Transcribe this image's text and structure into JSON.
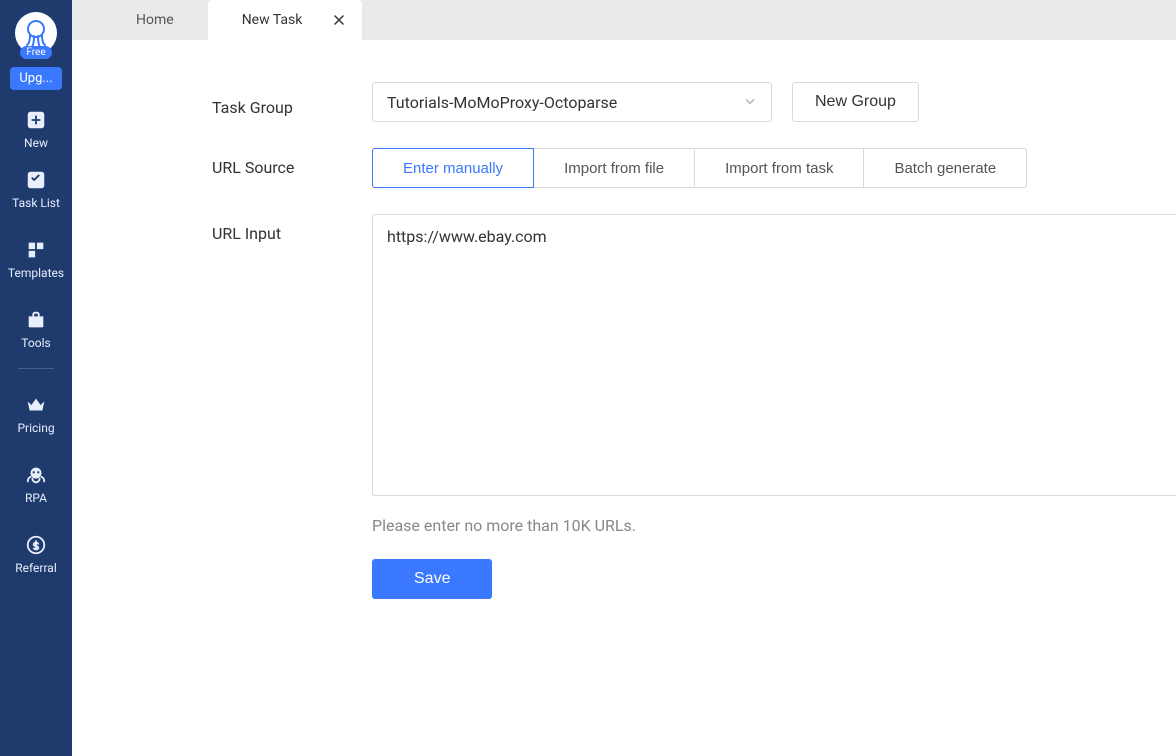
{
  "sidebar": {
    "free_badge": "Free",
    "upgrade_label": "Upg...",
    "items": {
      "new": "New",
      "task_list": "Task List",
      "templates": "Templates",
      "tools": "Tools",
      "pricing": "Pricing",
      "rpa": "RPA",
      "referral": "Referral"
    }
  },
  "tabs": {
    "home": "Home",
    "new_task": "New Task"
  },
  "content": {
    "task_group_label": "Task Group",
    "task_group_value": "Tutorials-MoMoProxy-Octoparse",
    "new_group_label": "New Group",
    "url_source_label": "URL Source",
    "url_source_options": {
      "enter_manually": "Enter manually",
      "import_file": "Import from file",
      "import_task": "Import from task",
      "batch_generate": "Batch generate"
    },
    "url_input_label": "URL Input",
    "url_input_value": "https://www.ebay.com",
    "hint": "Please enter no more than 10K URLs.",
    "save_label": "Save"
  }
}
